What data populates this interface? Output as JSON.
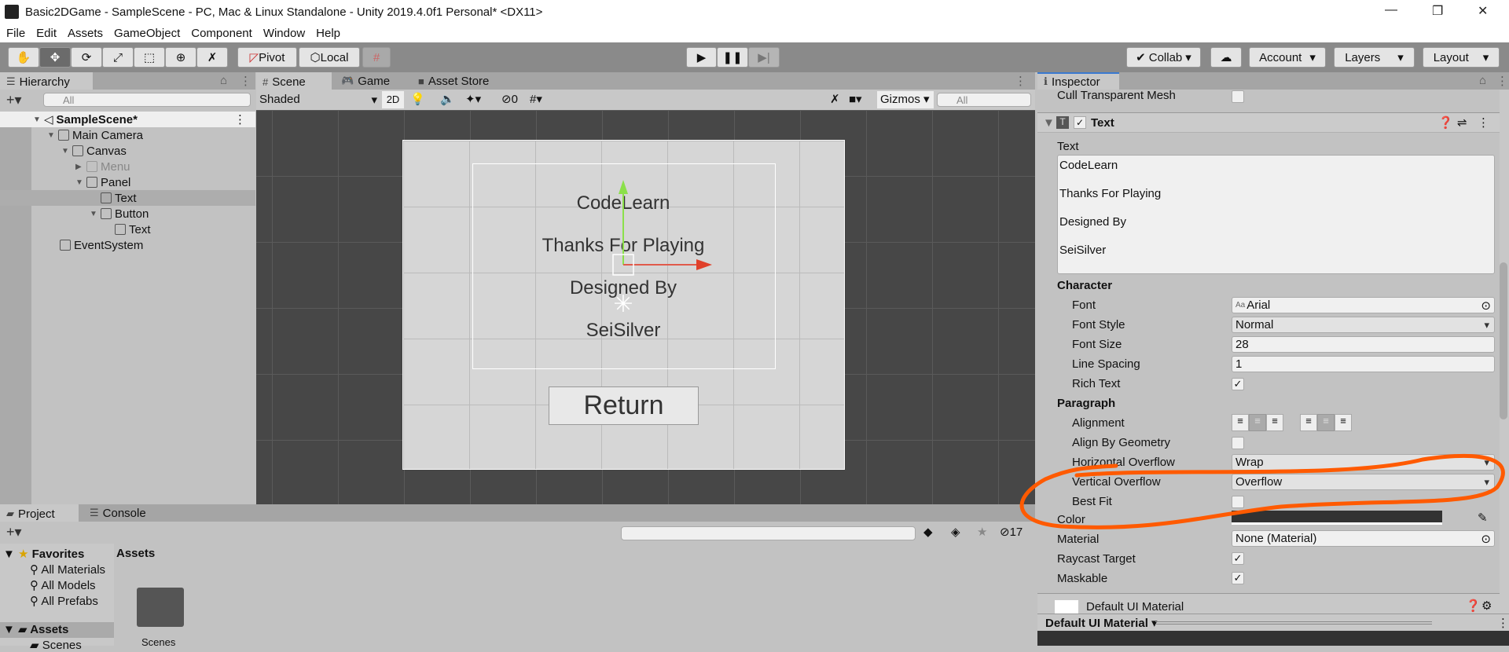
{
  "window": {
    "title": "Basic2DGame - SampleScene - PC, Mac & Linux Standalone - Unity 2019.4.0f1 Personal* <DX11>",
    "minimize": "—",
    "restore": "❐",
    "close": "✕"
  },
  "menu": [
    "File",
    "Edit",
    "Assets",
    "GameObject",
    "Component",
    "Window",
    "Help"
  ],
  "toolbar": {
    "pivot": "Pivot",
    "local": "Local",
    "collab": "Collab",
    "account": "Account",
    "layers": "Layers",
    "layout": "Layout"
  },
  "hierarchy": {
    "tab": "Hierarchy",
    "search_placeholder": "All",
    "scene": "SampleScene*",
    "items": [
      {
        "label": "Main Camera"
      },
      {
        "label": "Canvas"
      },
      {
        "label": "Menu"
      },
      {
        "label": "Panel"
      },
      {
        "label": "Text"
      },
      {
        "label": "Button"
      },
      {
        "label": "Text"
      },
      {
        "label": "EventSystem"
      }
    ]
  },
  "scene": {
    "tabs": [
      "Scene",
      "Game",
      "Asset Store"
    ],
    "shading": "Shaded",
    "mode2d": "2D",
    "hidden_count": "0",
    "gizmos": "Gizmos",
    "search_placeholder": "All",
    "lines": [
      "CodeLearn",
      "Thanks For Playing",
      "Designed By",
      "SeiSilver"
    ],
    "button": "Return"
  },
  "project": {
    "tabs": [
      "Project",
      "Console"
    ],
    "hidden_count": "17",
    "favorites": "Favorites",
    "fav_items": [
      "All Materials",
      "All Models",
      "All Prefabs"
    ],
    "assets": "Assets",
    "asset_items": [
      "Scenes"
    ],
    "assets_header": "Assets",
    "folder_label": "Scenes"
  },
  "inspector": {
    "tab": "Inspector",
    "cull": "Cull Transparent Mesh",
    "component": "Text",
    "text_label": "Text",
    "text_lines": [
      "CodeLearn",
      "Thanks For Playing",
      "Designed By",
      "SeiSilver"
    ],
    "character": "Character",
    "font_label": "Font",
    "font": "Arial",
    "font_style_label": "Font Style",
    "font_style": "Normal",
    "font_size_label": "Font Size",
    "font_size": "28",
    "line_spacing_label": "Line Spacing",
    "line_spacing": "1",
    "rich_text_label": "Rich Text",
    "paragraph": "Paragraph",
    "alignment_label": "Alignment",
    "align_geometry_label": "Align By Geometry",
    "h_overflow_label": "Horizontal Overflow",
    "h_overflow": "Wrap",
    "v_overflow_label": "Vertical Overflow",
    "v_overflow": "Overflow",
    "best_fit_label": "Best Fit",
    "color_label": "Color",
    "color_value": "#323232",
    "material_label": "Material",
    "material": "None (Material)",
    "raycast_label": "Raycast Target",
    "maskable_label": "Maskable",
    "default_material": "Default UI Material",
    "footer": "Default UI Material"
  },
  "colors": {
    "annotation": "#ff5a00",
    "accent": "#3a79d0"
  }
}
